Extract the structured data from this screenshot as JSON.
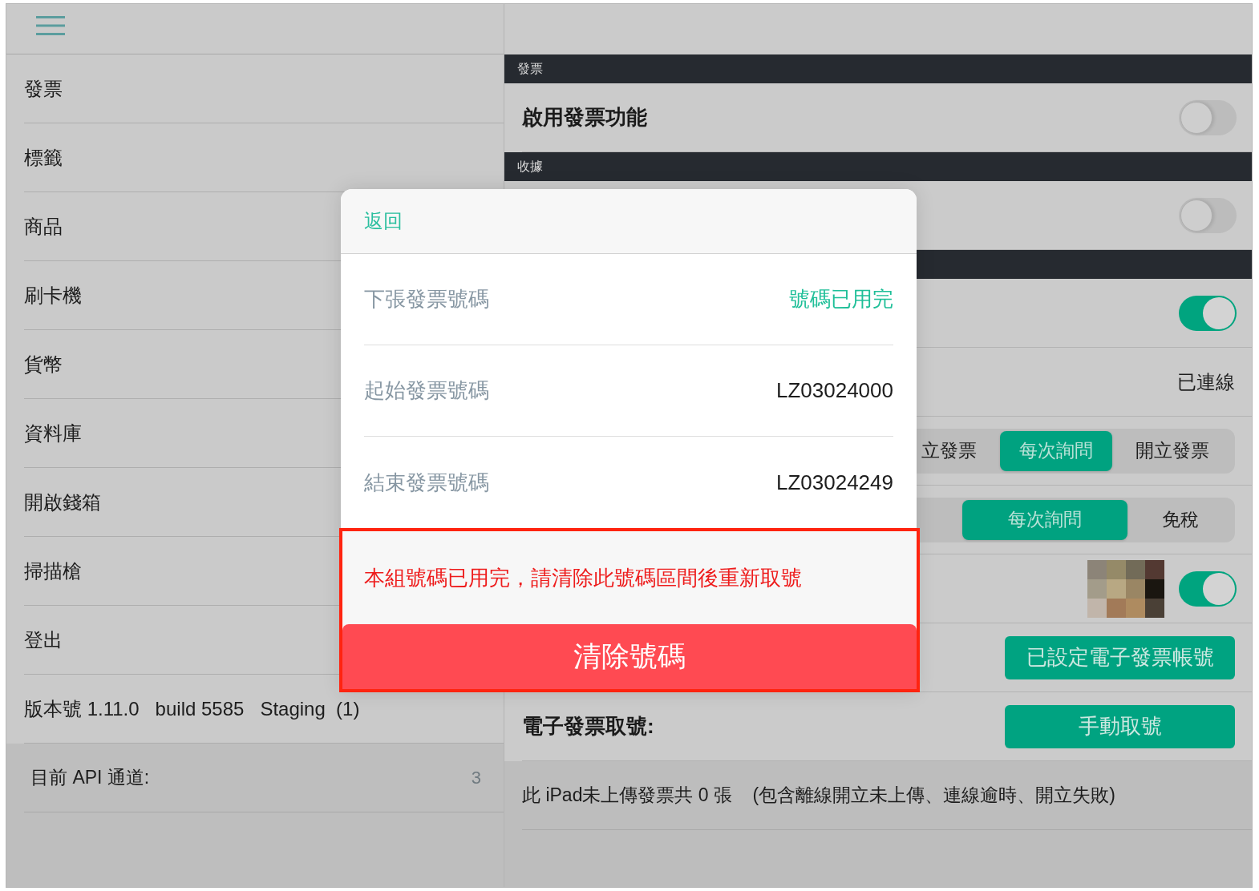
{
  "sidebar": {
    "items": [
      "發票",
      "標籤",
      "商品",
      "刷卡機",
      "貨幣",
      "資料庫",
      "開啟錢箱",
      "掃描槍",
      "登出"
    ],
    "version": "版本號 1.11.0   build 5585   Staging  (1)",
    "api_channel": {
      "label": "目前 API 通道:",
      "value": "3"
    }
  },
  "settings": {
    "sections": [
      {
        "header": "發票",
        "rows": [
          {
            "kind": "toggle",
            "label": "啟用發票功能",
            "on": false
          }
        ]
      },
      {
        "header": "收據",
        "rows": [
          {
            "kind": "toggle",
            "on": false
          }
        ]
      },
      {
        "rows": [
          {
            "kind": "toggle",
            "on": true
          },
          {
            "kind": "status",
            "value": "已連線"
          },
          {
            "kind": "segmented",
            "options": [
              {
                "label": "立發票",
                "selected": false
              },
              {
                "label": "每次詢問",
                "selected": true
              },
              {
                "label": "開立發票",
                "selected": false
              }
            ]
          },
          {
            "kind": "segmented",
            "options": [
              {
                "label": "每次詢問",
                "selected": true
              },
              {
                "label": "免稅",
                "selected": false
              }
            ]
          },
          {
            "kind": "photo_toggle",
            "on": true
          },
          {
            "kind": "button",
            "button": "已設定電子發票帳號"
          },
          {
            "kind": "button",
            "label": "電子發票取號:",
            "button": "手動取號"
          }
        ]
      }
    ],
    "footnote": "此 iPad未上傳發票共 0 張    (包含離線開立未上傳、連線逾時、開立失敗)"
  },
  "modal": {
    "back": "返回",
    "fields": [
      {
        "kind": "status",
        "label": "下張發票號碼",
        "value": "號碼已用完"
      },
      {
        "kind": "number",
        "label": "起始發票號碼",
        "value": "LZ03024000"
      },
      {
        "kind": "number",
        "label": "結束發票號碼",
        "value": "LZ03024249"
      }
    ],
    "message": "本組號碼已用完，請清除此號碼區間後重新取號",
    "button": "清除號碼"
  }
}
